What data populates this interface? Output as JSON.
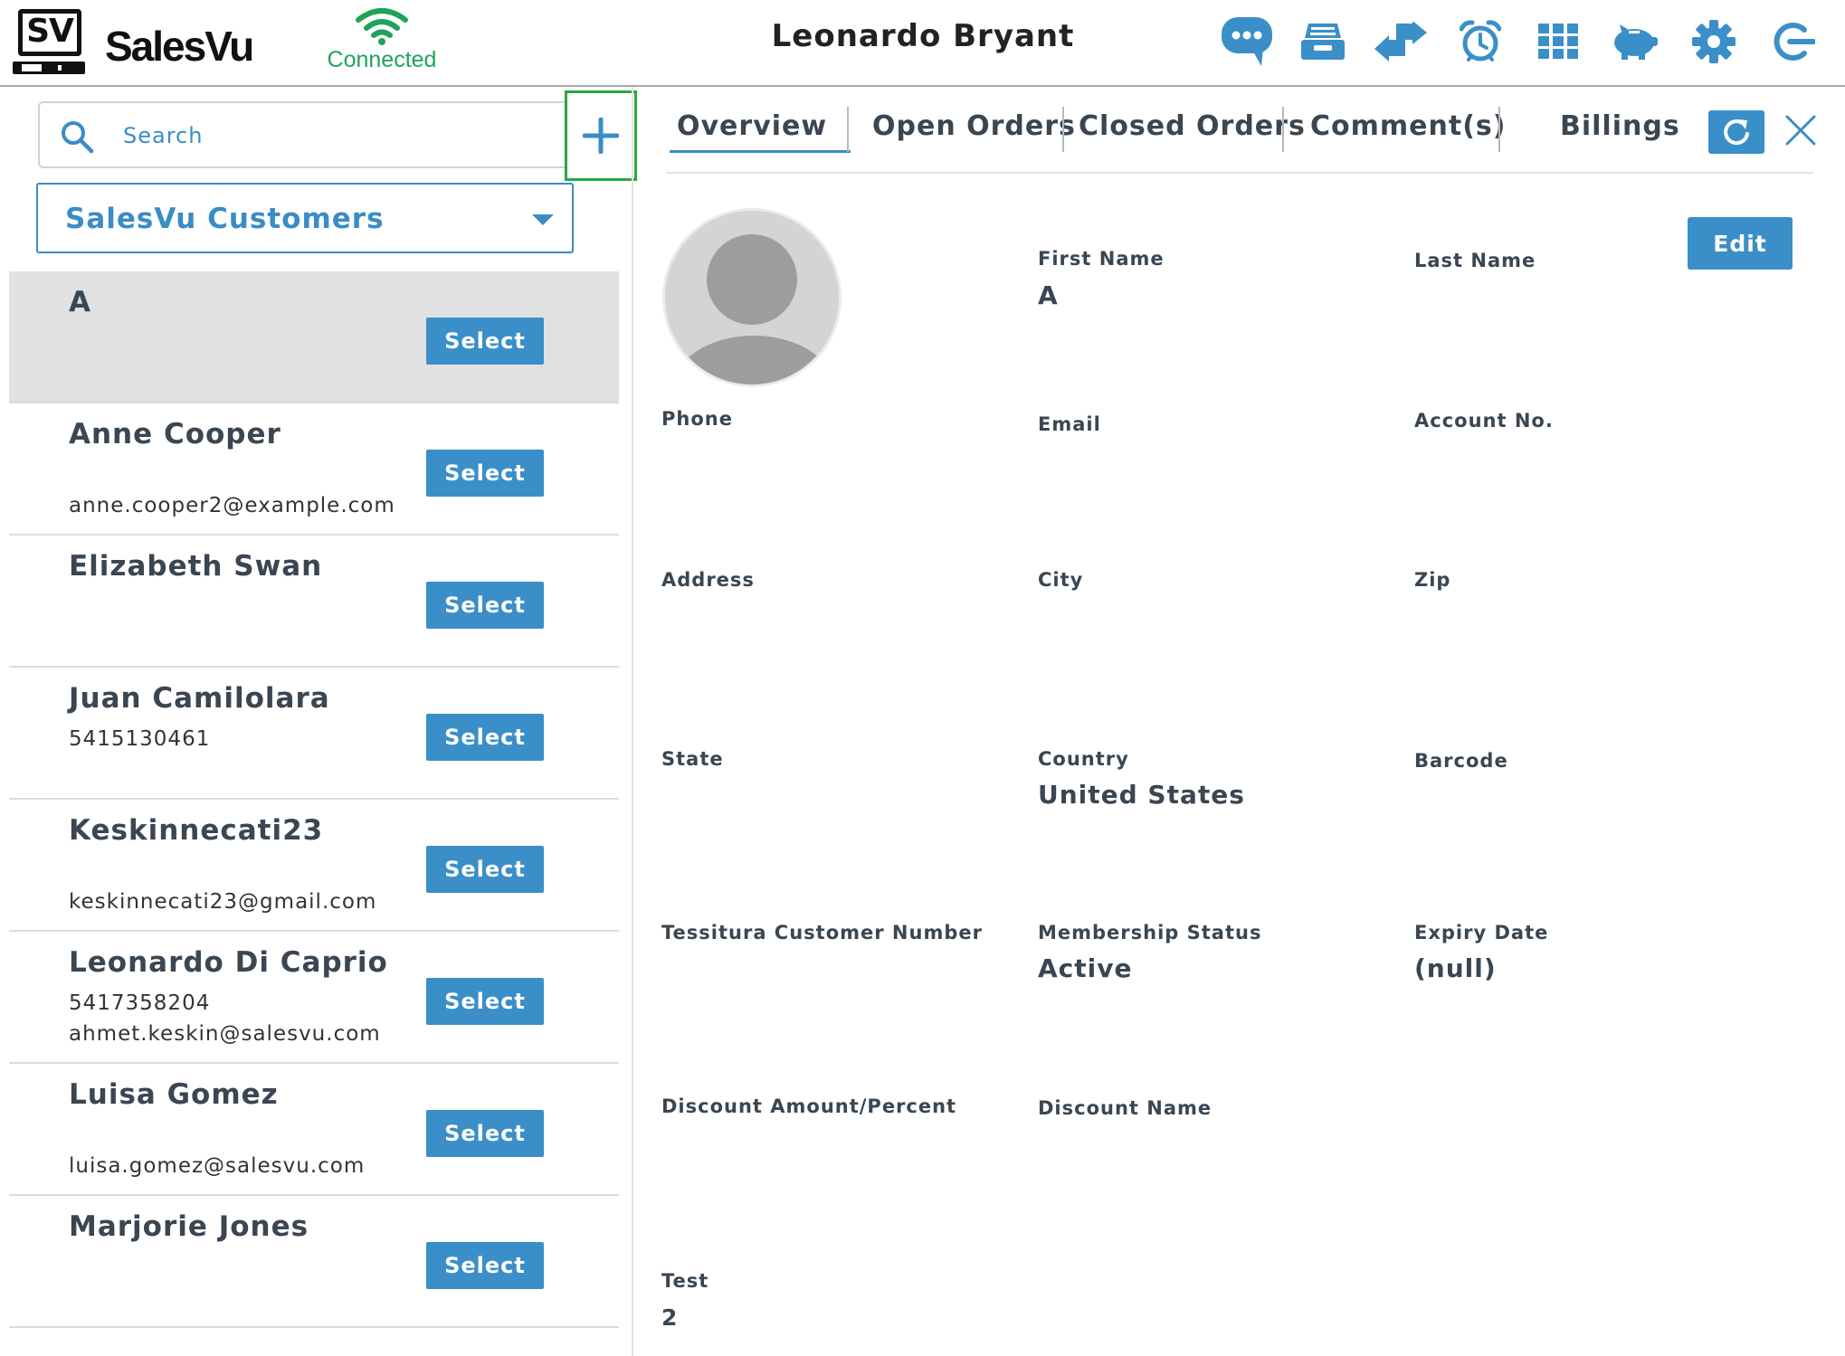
{
  "header": {
    "logo_text": "SV",
    "brand": "SalesVu",
    "connection_status": "Connected",
    "user_name": "Leonardo Bryant",
    "icons": [
      "chat-icon",
      "register-icon",
      "transfer-icon",
      "alarm-icon",
      "grid-icon",
      "piggy-bank-icon",
      "gear-icon",
      "logout-icon"
    ]
  },
  "colors": {
    "accent": "#3b8fc8",
    "connected": "#1fa35a",
    "add_highlight": "#28a745",
    "selected_row": "#e1e1e1"
  },
  "sidebar": {
    "search": {
      "placeholder": "Search",
      "value": ""
    },
    "customer_group": "SalesVu Customers",
    "select_label": "Select",
    "customers": [
      {
        "name": "A",
        "line1": "",
        "line2": "",
        "selected": true
      },
      {
        "name": "Anne Cooper",
        "line1": "",
        "line2": "anne.cooper2@example.com",
        "selected": false
      },
      {
        "name": "Elizabeth Swan",
        "line1": "",
        "line2": "",
        "selected": false
      },
      {
        "name": "Juan Camilolara",
        "line1": "5415130461",
        "line2": "",
        "selected": false
      },
      {
        "name": "Keskinnecati23",
        "line1": "",
        "line2": "keskinnecati23@gmail.com",
        "selected": false
      },
      {
        "name": "Leonardo Di Caprio",
        "line1": "5417358204",
        "line2": "ahmet.keskin@salesvu.com",
        "selected": false
      },
      {
        "name": "Luisa Gomez",
        "line1": "",
        "line2": "luisa.gomez@salesvu.com",
        "selected": false
      },
      {
        "name": "Marjorie Jones",
        "line1": "",
        "line2": "",
        "selected": false
      }
    ]
  },
  "tabs": [
    {
      "label": "Overview",
      "active": true
    },
    {
      "label": "Open Orders",
      "active": false
    },
    {
      "label": "Closed Orders",
      "active": false
    },
    {
      "label": "Comment(s)",
      "active": false
    },
    {
      "label": "Billings",
      "active": false
    }
  ],
  "detail": {
    "edit_label": "Edit",
    "fields": {
      "first_name": {
        "label": "First Name",
        "value": "A"
      },
      "last_name": {
        "label": "Last Name",
        "value": ""
      },
      "phone": {
        "label": "Phone",
        "value": ""
      },
      "email": {
        "label": "Email",
        "value": ""
      },
      "account_no": {
        "label": "Account No.",
        "value": ""
      },
      "address": {
        "label": "Address",
        "value": ""
      },
      "city": {
        "label": "City",
        "value": ""
      },
      "zip": {
        "label": "Zip",
        "value": ""
      },
      "state": {
        "label": "State",
        "value": ""
      },
      "country": {
        "label": "Country",
        "value": "United States"
      },
      "barcode": {
        "label": "Barcode",
        "value": ""
      },
      "tessitura": {
        "label": "Tessitura Customer Number",
        "value": ""
      },
      "membership_status": {
        "label": "Membership Status",
        "value": "Active"
      },
      "expiry_date": {
        "label": "Expiry Date",
        "value": "(null)"
      },
      "discount_amount": {
        "label": "Discount Amount/Percent",
        "value": ""
      },
      "discount_name": {
        "label": "Discount Name",
        "value": ""
      },
      "test": {
        "label": "Test",
        "value": "2"
      }
    }
  }
}
